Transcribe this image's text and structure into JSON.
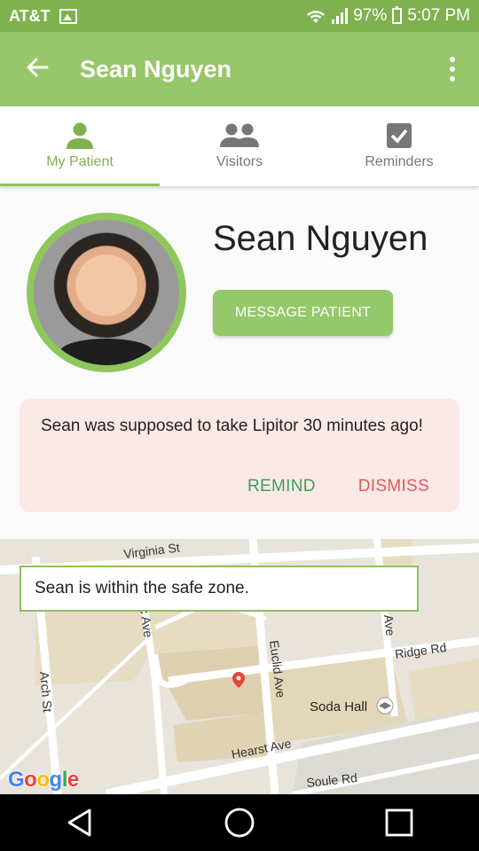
{
  "status_bar": {
    "carrier": "AT&T",
    "battery": "97%",
    "time": "5:07 PM"
  },
  "app_bar": {
    "title": "Sean Nguyen"
  },
  "tabs": [
    {
      "label": "My Patient",
      "icon": "person-icon",
      "active": true
    },
    {
      "label": "Visitors",
      "icon": "group-icon",
      "active": false
    },
    {
      "label": "Reminders",
      "icon": "checkbox-icon",
      "active": false
    }
  ],
  "profile": {
    "name": "Sean Nguyen",
    "message_button": "MESSAGE PATIENT"
  },
  "alert": {
    "text": "Sean was supposed to take Lipitor 30 minutes ago!",
    "remind": "REMIND",
    "dismiss": "DISMISS"
  },
  "map": {
    "safe_zone_text": "Sean is within the safe zone.",
    "streets": [
      "Virginia St",
      "Arch St",
      "c Ave",
      "Euclid Ave",
      "Ave",
      "Ridge Rd",
      "Hearst Ave",
      "Soule Rd"
    ],
    "places": [
      "Soda Hall"
    ],
    "google_logo": "Google"
  },
  "colors": {
    "primary": "#98c66a",
    "status_bar": "#7fb24e",
    "alert_bg": "#fbe9e8",
    "remind": "#3aa157",
    "dismiss": "#e15a5a"
  }
}
